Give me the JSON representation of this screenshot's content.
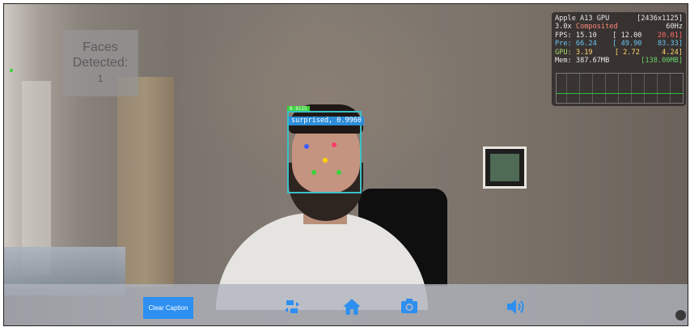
{
  "faces_panel": {
    "label": "Faces\nDetected:",
    "count": "1"
  },
  "stats": {
    "gpu": "Apple A13 GPU",
    "resolution": "[2436x1125]",
    "scale": "3.0x",
    "mode": "Composited",
    "refresh": "60Hz",
    "fps": {
      "label": "FPS:",
      "cur": "15.10",
      "min": "[ 12.00",
      "max": "20.01]"
    },
    "pre": {
      "label": "Pre:",
      "cur": "66.24",
      "min": "[ 49.90",
      "max": "83.33]"
    },
    "gpu_time": {
      "label": "GPU:",
      "cur": "3.19",
      "min": "[ 2.72",
      "max": "4.24]"
    },
    "mem": {
      "label": "Mem:",
      "cur": "387.67MB",
      "max": "[138.00MB]"
    }
  },
  "detection": {
    "tag": "0.9115",
    "label": "surprised, 0.9960"
  },
  "toolbar": {
    "clear_caption": "Clear Caption",
    "icons": [
      "rotate-camera-icon",
      "home-icon",
      "camera-icon",
      "volume-icon"
    ]
  },
  "colors": {
    "accent": "#2d8ff0",
    "box": "#39c1c8",
    "label_bg": "#2d8dd8",
    "tag_bg": "#39d23a"
  }
}
